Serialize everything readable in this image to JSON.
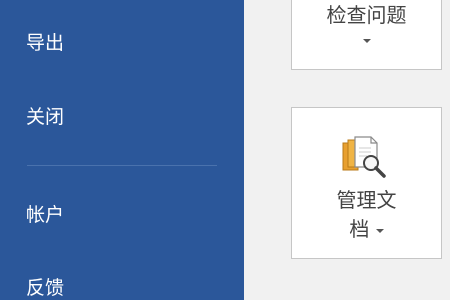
{
  "sidebar": {
    "items": [
      {
        "label": "导出"
      },
      {
        "label": "关闭"
      },
      {
        "label": "帐户"
      },
      {
        "label": "反馈"
      }
    ]
  },
  "main": {
    "inspect_tile": {
      "label": "检查问题"
    },
    "manage_tile": {
      "label_line1": "管理文",
      "label_line2": "档"
    }
  },
  "colors": {
    "sidebar_bg": "#2b579a",
    "content_bg": "#f1f1f1",
    "tile_border": "#c6c6c6",
    "icon_orange": "#e8a030"
  },
  "icons": {
    "dropdown": "chevron-down-icon",
    "manage_document": "manage-document-icon"
  }
}
